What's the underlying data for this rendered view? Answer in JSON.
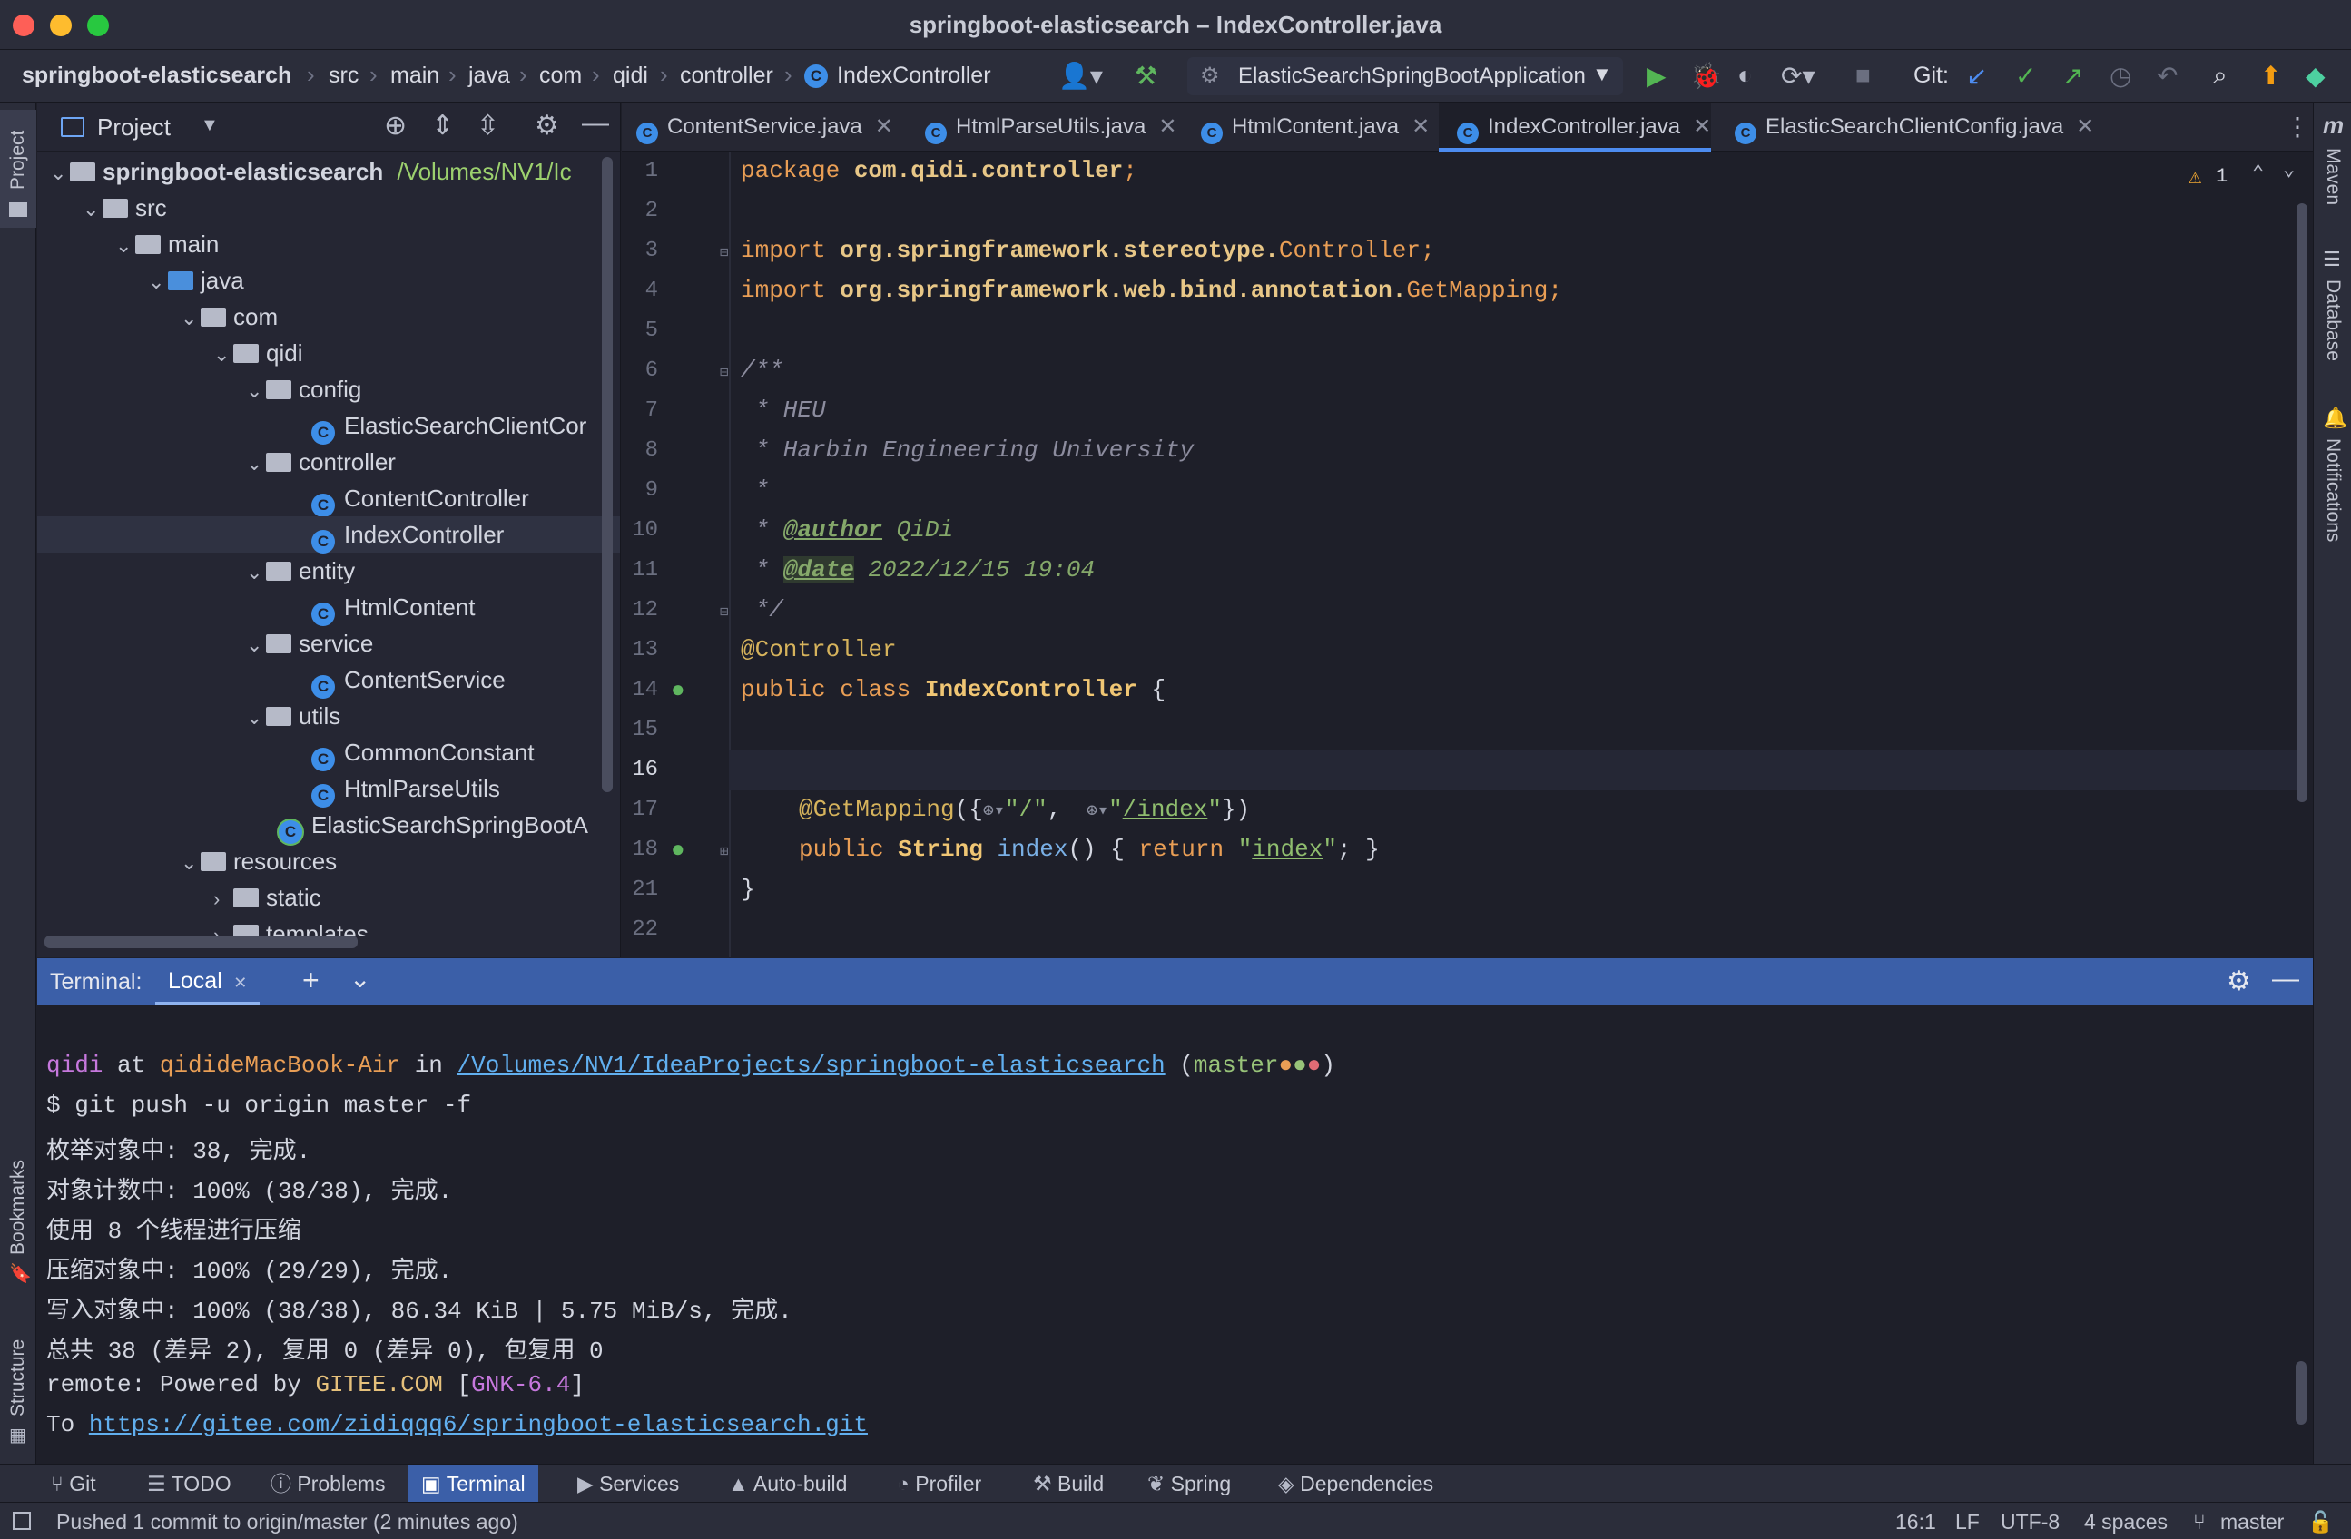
{
  "window": {
    "title": "springboot-elasticsearch – IndexController.java"
  },
  "breadcrumbs": [
    "springboot-elasticsearch",
    "src",
    "main",
    "java",
    "com",
    "qidi",
    "controller",
    "IndexController"
  ],
  "navbar": {
    "run_config": "ElasticSearchSpringBootApplication",
    "git_label": "Git:"
  },
  "left_strip": {
    "project": "Project",
    "bookmarks": "Bookmarks",
    "structure": "Structure"
  },
  "right_strip": {
    "maven": "Maven",
    "database": "Database",
    "notifications": "Notifications"
  },
  "project_panel": {
    "title": "Project",
    "root_name": "springboot-elasticsearch",
    "root_path": "/Volumes/NV1/Ic",
    "items": [
      {
        "label": "src",
        "kind": "folder"
      },
      {
        "label": "main",
        "kind": "folder"
      },
      {
        "label": "java",
        "kind": "folder-blue"
      },
      {
        "label": "com",
        "kind": "package"
      },
      {
        "label": "qidi",
        "kind": "package"
      },
      {
        "label": "config",
        "kind": "package"
      },
      {
        "label": "ElasticSearchClientCor",
        "kind": "class"
      },
      {
        "label": "controller",
        "kind": "package"
      },
      {
        "label": "ContentController",
        "kind": "class"
      },
      {
        "label": "IndexController",
        "kind": "class"
      },
      {
        "label": "entity",
        "kind": "package"
      },
      {
        "label": "HtmlContent",
        "kind": "class"
      },
      {
        "label": "service",
        "kind": "package"
      },
      {
        "label": "ContentService",
        "kind": "class"
      },
      {
        "label": "utils",
        "kind": "package"
      },
      {
        "label": "CommonConstant",
        "kind": "class"
      },
      {
        "label": "HtmlParseUtils",
        "kind": "class"
      },
      {
        "label": "ElasticSearchSpringBootA",
        "kind": "app-class"
      },
      {
        "label": "resources",
        "kind": "folder"
      },
      {
        "label": "static",
        "kind": "folder"
      },
      {
        "label": "templates",
        "kind": "folder"
      }
    ]
  },
  "tabs": [
    {
      "label": "ContentService.java",
      "active": false
    },
    {
      "label": "HtmlParseUtils.java",
      "active": false
    },
    {
      "label": "HtmlContent.java",
      "active": false
    },
    {
      "label": "IndexController.java",
      "active": true
    },
    {
      "label": "ElasticSearchClientConfig.java",
      "active": false
    }
  ],
  "editor": {
    "warning_count": "1",
    "line_numbers": [
      "1",
      "2",
      "3",
      "4",
      "5",
      "6",
      "7",
      "8",
      "9",
      "10",
      "11",
      "12",
      "13",
      "14",
      "15",
      "16",
      "17",
      "18",
      "21",
      "22"
    ],
    "code": {
      "l1_kw": "package ",
      "l1_pkg": "com.qidi.controller",
      "l1_end": ";",
      "l3_kw": "import ",
      "l3_pkg": "org.springframework.stereotype.",
      "l3_cls": "Controller",
      "l3_end": ";",
      "l4_kw": "import ",
      "l4_pkg": "org.springframework.web.bind.annotation.",
      "l4_cls": "GetMapping",
      "l4_end": ";",
      "l6": "/**",
      "l7": " * HEU",
      "l8": " * Harbin Engineering University",
      "l9": " *",
      "l10_star": " * ",
      "l10_tag": "@author",
      "l10_val": " QiDi",
      "l11_star": " * ",
      "l11_tag": "@date",
      "l11_val": " 2022/12/15 19:04",
      "l12": " */",
      "l13": "@Controller",
      "l14_kw": "public class ",
      "l14_cls": "IndexController",
      "l14_end": " {",
      "l17_ann": "@GetMapping",
      "l17_open": "({",
      "l17_s1": "\"/\"",
      "l17_comma": ", ",
      "l17_s2a": "\"",
      "l17_s2b": "/index",
      "l17_s2c": "\"",
      "l17_close": "})",
      "l18_kw": "public ",
      "l18_type": "String ",
      "l18_fn": "index",
      "l18_mid": "() { ",
      "l18_ret": "return ",
      "l18_q1": "\"",
      "l18_str": "index",
      "l18_q2": "\"",
      "l18_end": "; }",
      "l21": "}"
    }
  },
  "terminal": {
    "header_label": "Terminal:",
    "tab_label": "Local",
    "prompt_user": "qidi",
    "prompt_at": " at ",
    "prompt_host": "qidideMacBook-Air",
    "prompt_in": " in ",
    "prompt_path": "/Volumes/NV1/IdeaProjects/springboot-elasticsearch",
    "prompt_branch": "master",
    "lines": [
      "$ git push -u origin master -f",
      "枚举对象中: 38, 完成.",
      "对象计数中: 100% (38/38), 完成.",
      "使用 8 个线程进行压缩",
      "压缩对象中: 100% (29/29), 完成.",
      "写入对象中: 100% (38/38), 86.34 KiB | 5.75 MiB/s, 完成.",
      "总共 38 (差异 2), 复用 0 (差异 0), 包复用 0"
    ],
    "remote_prefix": "remote: Powered by ",
    "remote_brand": "GITEE.COM",
    "remote_bracket_open": " [",
    "remote_ver": "GNK-6.4",
    "remote_bracket_close": "]",
    "to_prefix": "To ",
    "to_url": "https://gitee.com/zidiqqq6/springboot-elasticsearch.git"
  },
  "toolwindows": [
    "Git",
    "TODO",
    "Problems",
    "Terminal",
    "Services",
    "Auto-build",
    "Profiler",
    "Build",
    "Spring",
    "Dependencies"
  ],
  "status": {
    "message": "Pushed 1 commit to origin/master (2 minutes ago)",
    "position": "16:1",
    "line_sep": "LF",
    "encoding": "UTF-8",
    "indent": "4 spaces",
    "branch": "master"
  },
  "colors": {
    "accent": "#3b5fa8",
    "background": "#1e1f29",
    "panel": "#252633"
  }
}
